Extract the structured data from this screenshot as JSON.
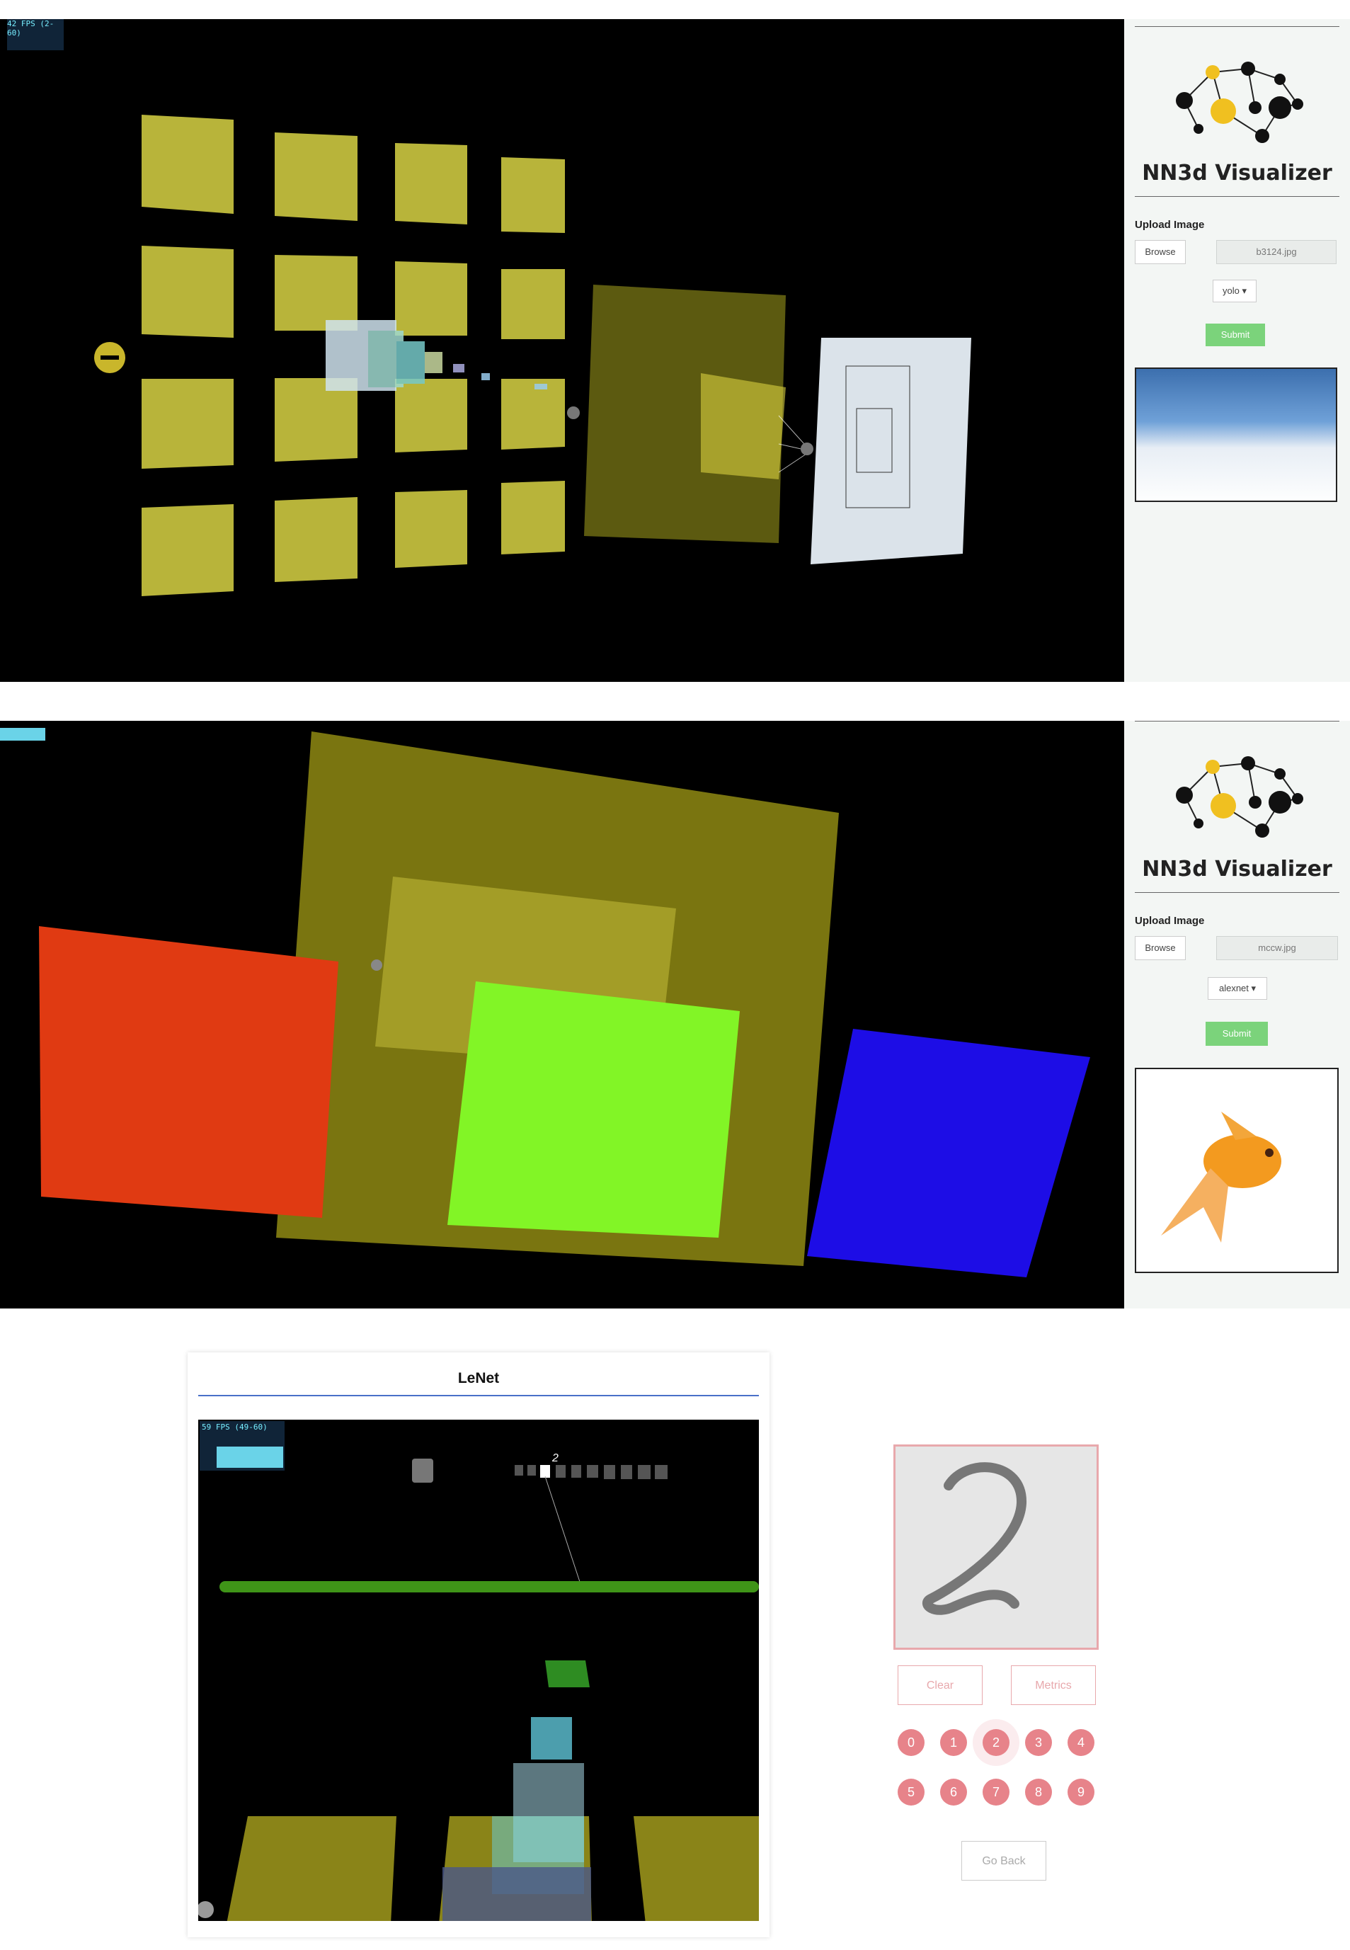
{
  "panel1": {
    "fps": "42 FPS (2-60)",
    "sidebar": {
      "title": "NN3d Visualizer",
      "upload_label": "Upload Image",
      "browse_label": "Browse",
      "file_name": "b3124.jpg",
      "model": "yolo",
      "submit_label": "Submit"
    }
  },
  "panel2": {
    "sidebar": {
      "title": "NN3d Visualizer",
      "upload_label": "Upload Image",
      "browse_label": "Browse",
      "file_name": "mccw.jpg",
      "model": "alexnet",
      "submit_label": "Submit"
    }
  },
  "panel3": {
    "title": "LeNet",
    "fps": "59 FPS (49-60)",
    "output_label": "2",
    "clear_label": "Clear",
    "metrics_label": "Metrics",
    "digits": [
      "0",
      "1",
      "2",
      "3",
      "4",
      "5",
      "6",
      "7",
      "8",
      "9"
    ],
    "go_back_label": "Go Back"
  },
  "colors": {
    "feature_map": "#c9c44a",
    "accent_green": "#7bd37b",
    "digit_pink": "#e7838a"
  }
}
